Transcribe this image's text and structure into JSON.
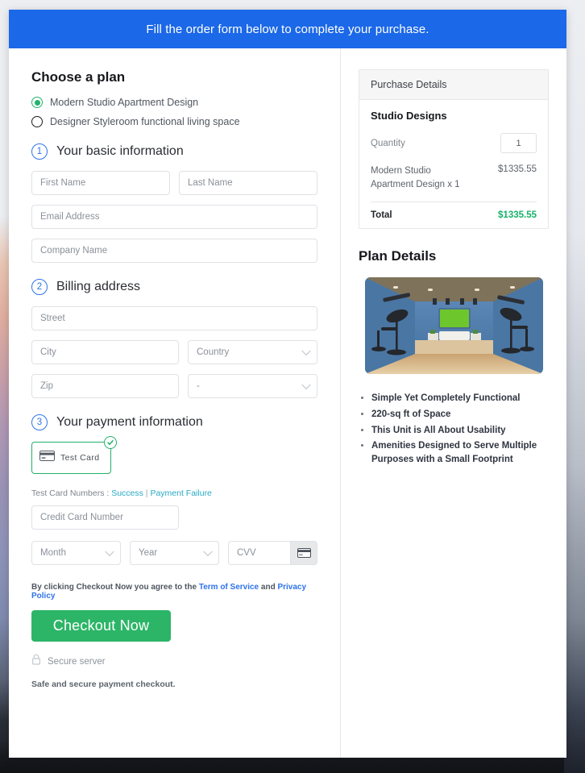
{
  "banner": {
    "text": "Fill the order form below to complete your purchase."
  },
  "plan": {
    "heading": "Choose a plan",
    "options": [
      {
        "label": "Modern Studio Apartment Design",
        "selected": true
      },
      {
        "label": "Designer Styleroom functional living space",
        "selected": false
      }
    ]
  },
  "steps": {
    "basic": {
      "number": "1",
      "label": "Your basic information"
    },
    "billing": {
      "number": "2",
      "label": "Billing address"
    },
    "payment": {
      "number": "3",
      "label": "Your payment information"
    }
  },
  "fields": {
    "first_name": {
      "placeholder": "First Name",
      "value": ""
    },
    "last_name": {
      "placeholder": "Last Name",
      "value": ""
    },
    "email": {
      "placeholder": "Email Address",
      "value": ""
    },
    "company": {
      "placeholder": "Company Name",
      "value": ""
    },
    "street": {
      "placeholder": "Street",
      "value": ""
    },
    "city": {
      "placeholder": "City",
      "value": ""
    },
    "country": {
      "placeholder": "Country",
      "value": ""
    },
    "zip": {
      "placeholder": "Zip",
      "value": ""
    },
    "state": {
      "placeholder": "-",
      "value": ""
    },
    "card_number": {
      "placeholder": "Credit Card Number",
      "value": ""
    },
    "month": {
      "placeholder": "Month",
      "value": ""
    },
    "year": {
      "placeholder": "Year",
      "value": ""
    },
    "cvv": {
      "placeholder": "CVV",
      "value": ""
    }
  },
  "payment_method": {
    "tile_label": "Test Card",
    "selected": true,
    "test_numbers_prefix": "Test Card Numbers : ",
    "success_link": "Success",
    "separator": " | ",
    "failure_link": "Payment Failure"
  },
  "footer": {
    "terms_prefix": "By clicking Checkout Now you agree to the ",
    "terms_link": "Term of Service",
    "terms_and": " and ",
    "privacy_link": "Privacy Policy",
    "checkout_button": "Checkout Now",
    "secure_server": "Secure server",
    "safe_note": "Safe and secure payment checkout."
  },
  "purchase": {
    "header": "Purchase Details",
    "product_title": "Studio Designs",
    "quantity_label": "Quantity",
    "quantity_value": "1",
    "line_item_desc": "Modern Studio Apartment Design x 1",
    "line_item_amount": "$1335.55",
    "total_label": "Total",
    "total_amount": "$1335.55"
  },
  "plan_details": {
    "title": "Plan Details",
    "image_alt": "studio-room-photo",
    "bullets": [
      "Simple Yet Completely Functional",
      "220-sq ft of Space",
      "This Unit is All About Usability",
      "Amenities Designed to Serve Multiple Purposes with a Small Footprint"
    ]
  },
  "colors": {
    "banner_blue": "#1b68e8",
    "accent_green": "#2cb567",
    "total_green": "#17b26a",
    "step_blue": "#2e73e8",
    "link_teal": "#2aa9c4"
  }
}
